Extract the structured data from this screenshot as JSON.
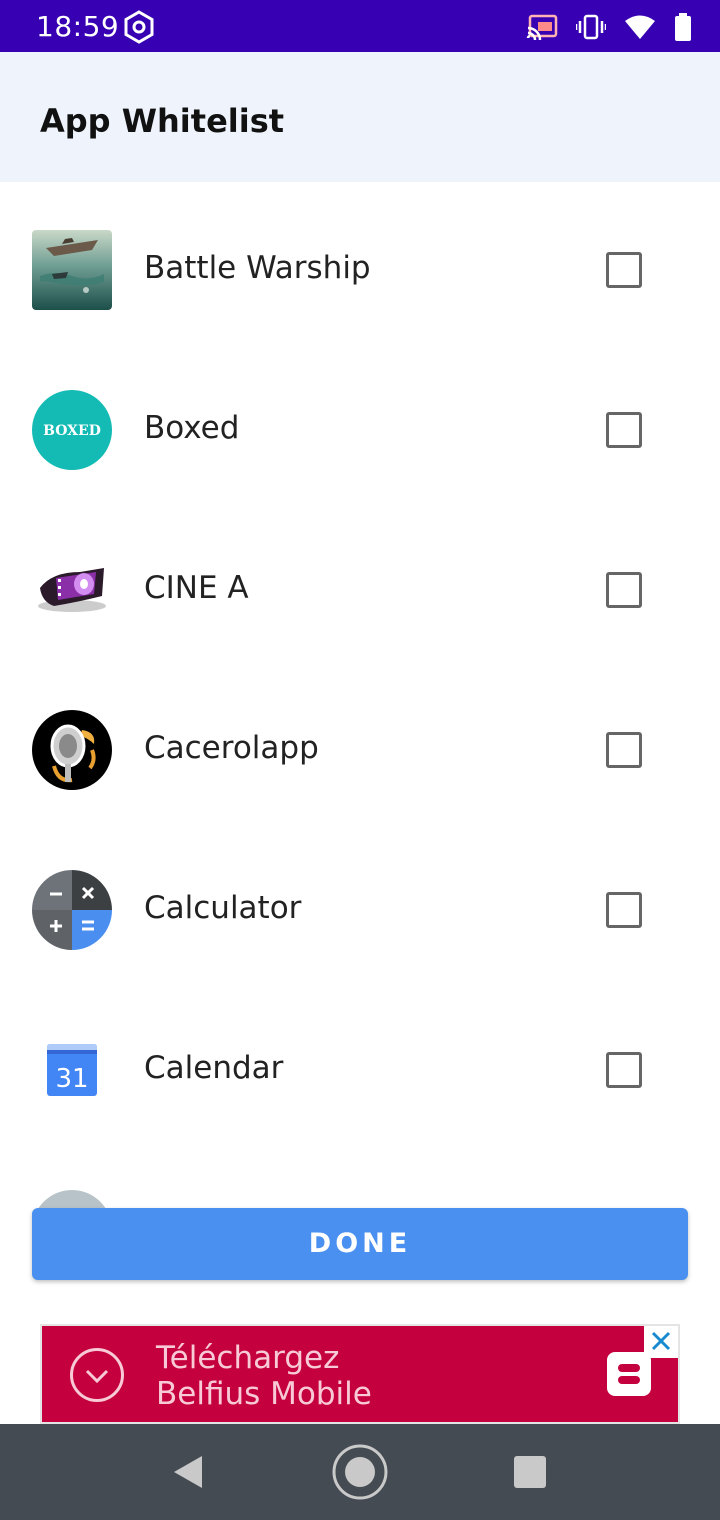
{
  "status_bar": {
    "time": "18:59",
    "icons": [
      "app-notification-icon",
      "cast-icon",
      "vibrate-icon",
      "wifi-icon",
      "battery-icon"
    ]
  },
  "app_bar": {
    "title": "App Whitelist"
  },
  "apps": [
    {
      "name": "Battle Warship",
      "icon": "battle-warship-icon",
      "checked": false
    },
    {
      "name": "Boxed",
      "icon": "boxed-icon",
      "icon_text": "BOXED",
      "checked": false
    },
    {
      "name": "CINE A",
      "icon": "cine-a-icon",
      "checked": false
    },
    {
      "name": "Cacerolapp",
      "icon": "cacerolapp-icon",
      "checked": false
    },
    {
      "name": "Calculator",
      "icon": "calculator-icon",
      "checked": false
    },
    {
      "name": "Calendar",
      "icon": "calendar-icon",
      "icon_text": "31",
      "checked": false
    },
    {
      "name": "",
      "icon": "partially-visible-app-icon",
      "checked": false
    }
  ],
  "done_button": {
    "label": "DONE"
  },
  "ad": {
    "line1": "Téléchargez",
    "line2": "Belfius Mobile",
    "colors": {
      "background": "#c4003f",
      "text": "#f8c9d6"
    }
  },
  "nav_bar": {
    "icons": [
      "back-icon",
      "home-icon",
      "recents-icon"
    ]
  },
  "colors": {
    "status_bar": "#3700b3",
    "app_bar": "#eef3fc",
    "primary_button": "#4a90f0"
  }
}
